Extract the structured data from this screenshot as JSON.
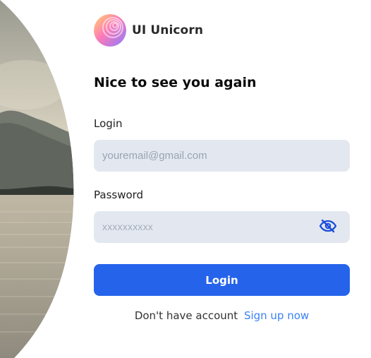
{
  "brand": {
    "name": "UI Unicorn",
    "logo_icon": "gradient-spiral-logo-icon"
  },
  "form": {
    "title": "Nice to see you again",
    "login_label": "Login",
    "email_placeholder": "youremail@gmail.com",
    "password_label": "Password",
    "password_placeholder": "xxxxxxxxxx",
    "password_toggle_icon": "eye-slash-icon",
    "submit_label": "Login"
  },
  "footer": {
    "prompt_text": "Don't have account",
    "signup_link": "Sign up now"
  },
  "colors": {
    "primary": "#2563eb",
    "link": "#3b82f6",
    "input_bg": "#e3e8f0"
  }
}
